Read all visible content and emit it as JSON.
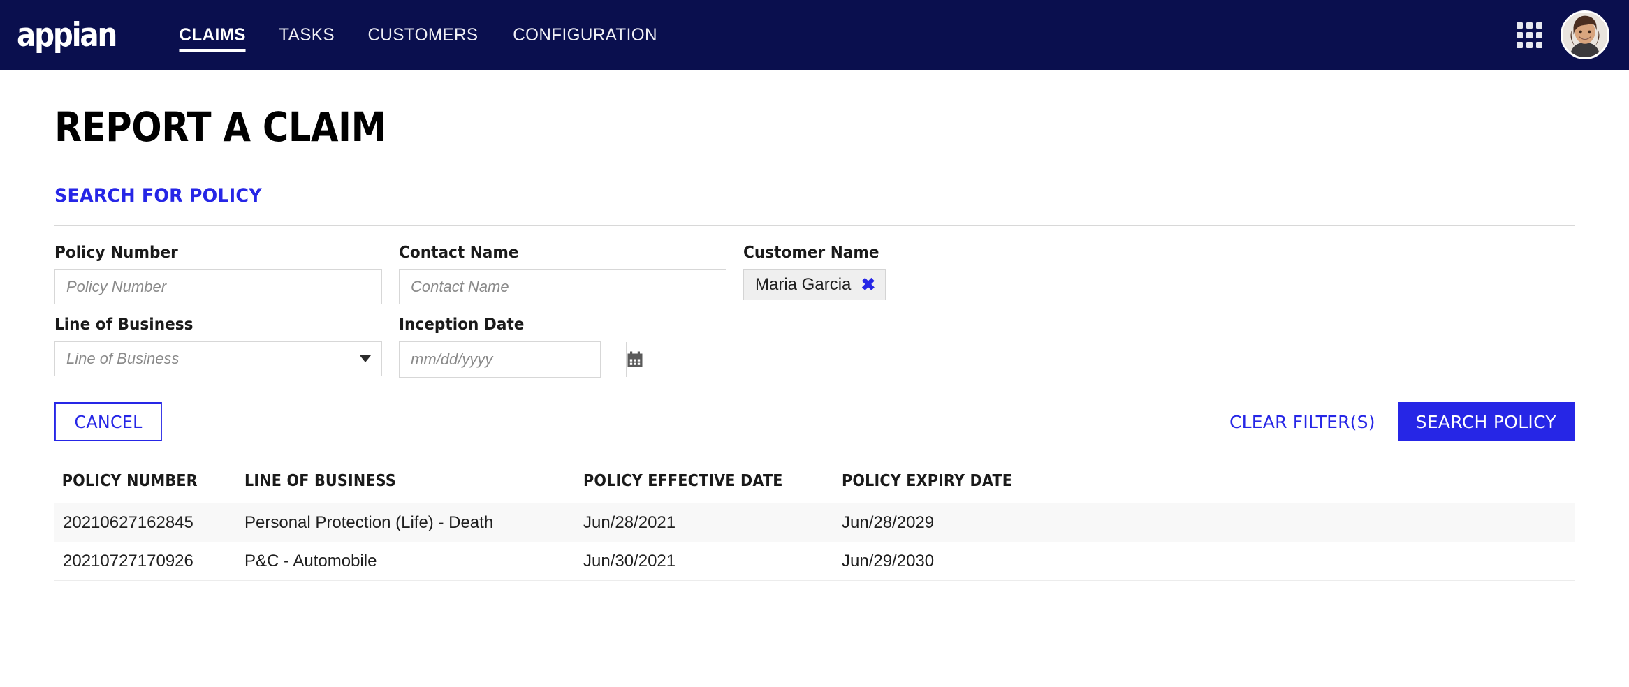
{
  "header": {
    "logo_text": "appian",
    "nav_items": [
      {
        "label": "CLAIMS",
        "active": true
      },
      {
        "label": "TASKS",
        "active": false
      },
      {
        "label": "CUSTOMERS",
        "active": false
      },
      {
        "label": "CONFIGURATION",
        "active": false
      }
    ],
    "apps_icon": "grid-apps-icon",
    "avatar_alt": "user-avatar",
    "background_color": "#0a0f4e"
  },
  "page": {
    "title": "REPORT A CLAIM",
    "section_title": "SEARCH FOR POLICY"
  },
  "form": {
    "policy_number": {
      "label": "Policy Number",
      "placeholder": "Policy Number",
      "value": ""
    },
    "contact_name": {
      "label": "Contact Name",
      "placeholder": "Contact Name",
      "value": ""
    },
    "customer_name": {
      "label": "Customer Name",
      "chip_value": "Maria Garcia",
      "remove_icon": "close-x-icon"
    },
    "line_of_business": {
      "label": "Line of Business",
      "placeholder": "Line of Business",
      "value": ""
    },
    "inception_date": {
      "label": "Inception Date",
      "placeholder": "mm/dd/yyyy",
      "value": "",
      "calendar_icon": "calendar-icon"
    }
  },
  "buttons": {
    "cancel": "CANCEL",
    "clear_filters": "CLEAR FILTER(S)",
    "search_policy": "SEARCH POLICY",
    "primary_color": "#2626e6"
  },
  "results_table": {
    "columns": [
      "POLICY NUMBER",
      "LINE OF BUSINESS",
      "POLICY EFFECTIVE DATE",
      "POLICY EXPIRY DATE"
    ],
    "rows": [
      {
        "policy_number": "20210627162845",
        "line_of_business": "Personal Protection (Life) - Death",
        "policy_effective_date": "Jun/28/2021",
        "policy_expiry_date": "Jun/28/2029"
      },
      {
        "policy_number": "20210727170926",
        "line_of_business": "P&C - Automobile",
        "policy_effective_date": "Jun/30/2021",
        "policy_expiry_date": "Jun/29/2030"
      }
    ]
  }
}
